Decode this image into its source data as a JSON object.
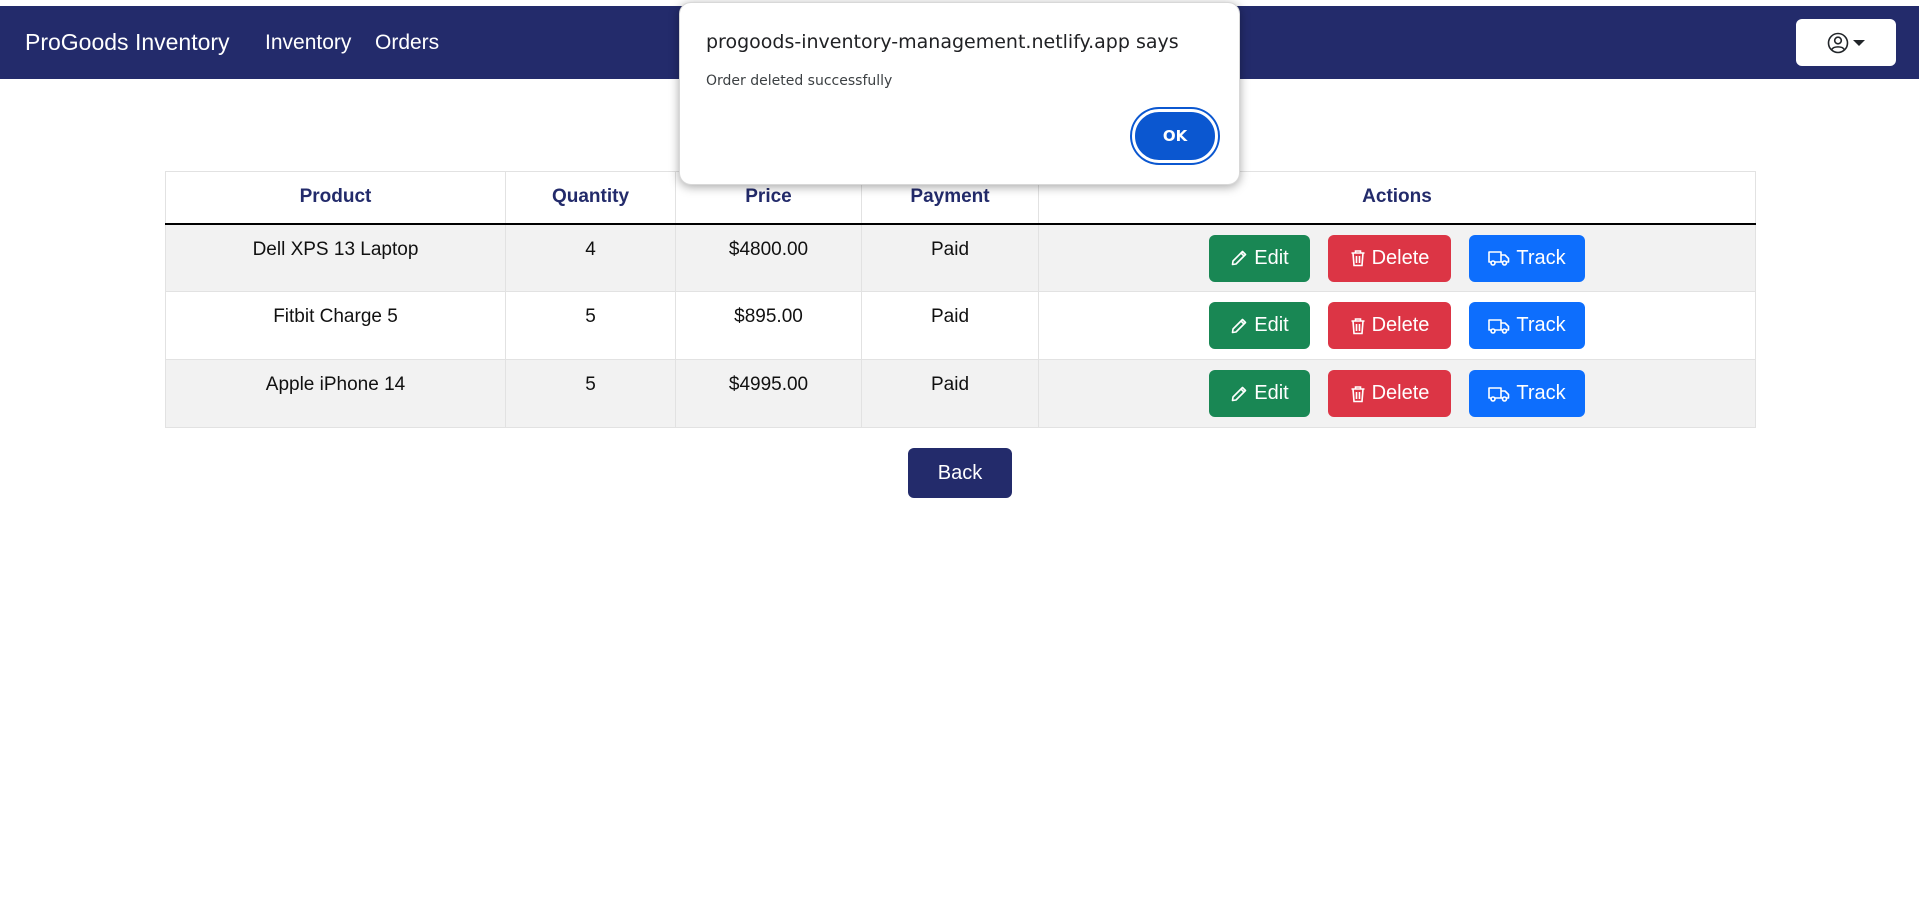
{
  "navbar": {
    "brand": "ProGoods Inventory",
    "links": [
      "Inventory",
      "Orders"
    ],
    "user_icon": "user-circle-icon"
  },
  "table": {
    "headers": [
      "Product",
      "Quantity",
      "Price",
      "Payment",
      "Actions"
    ],
    "rows": [
      {
        "product": "Dell XPS 13 Laptop",
        "quantity": "4",
        "price": "$4800.00",
        "payment": "Paid"
      },
      {
        "product": "Fitbit Charge 5",
        "quantity": "5",
        "price": "$895.00",
        "payment": "Paid"
      },
      {
        "product": "Apple iPhone 14",
        "quantity": "5",
        "price": "$4995.00",
        "payment": "Paid"
      }
    ],
    "actions": {
      "edit": "Edit",
      "delete": "Delete",
      "track": "Track"
    }
  },
  "back_label": "Back",
  "dialog": {
    "title": "progoods-inventory-management.netlify.app says",
    "message": "Order deleted successfully",
    "ok_label": "OK"
  },
  "colors": {
    "navbar": "#232b6b",
    "edit": "#198754",
    "delete": "#dc3545",
    "track": "#0d6efd",
    "ok": "#0b57d0"
  }
}
